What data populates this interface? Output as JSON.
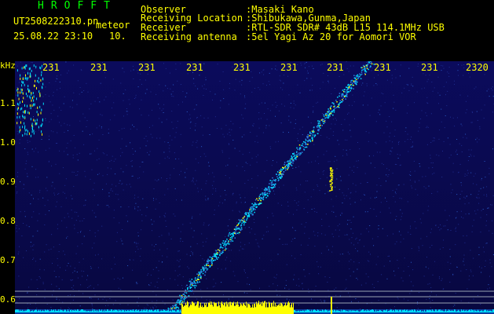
{
  "app": {
    "name": "HROFFT"
  },
  "capture": {
    "filename": "UT2508222310.pn",
    "tag": "meteor",
    "datetime": "25.08.22 23:10",
    "minutes": "10."
  },
  "info": {
    "rows": [
      {
        "label": "Observer",
        "value": ":Masaki Kano"
      },
      {
        "label": "Receiving Location",
        "value": ":Shibukawa,Gunma,Japan"
      },
      {
        "label": "Receiver",
        "value": ":RTL-SDR SDR# 43dB L15 114.1MHz USB"
      },
      {
        "label": "Receiving antenna",
        "value": ":5el Yagi Az 20 for Aomori VOR"
      }
    ]
  },
  "axes": {
    "y_unit": "kHz",
    "y_ticks": [
      "1.1",
      "1.0",
      "0.9",
      "0.8",
      "0.7",
      "0.6"
    ],
    "x_ticks": [
      "231",
      "231",
      "231",
      "231",
      "231",
      "231",
      "231",
      "231",
      "231",
      "2320"
    ]
  },
  "colors": {
    "background": "#000000",
    "plot_background": "#0a0a55",
    "header_text": "#ffff00",
    "title_text": "#00ff00",
    "signal_strong": "#ffff00",
    "signal_mid": "#00e0ff",
    "guide_lines": "#9aa3b3"
  }
}
